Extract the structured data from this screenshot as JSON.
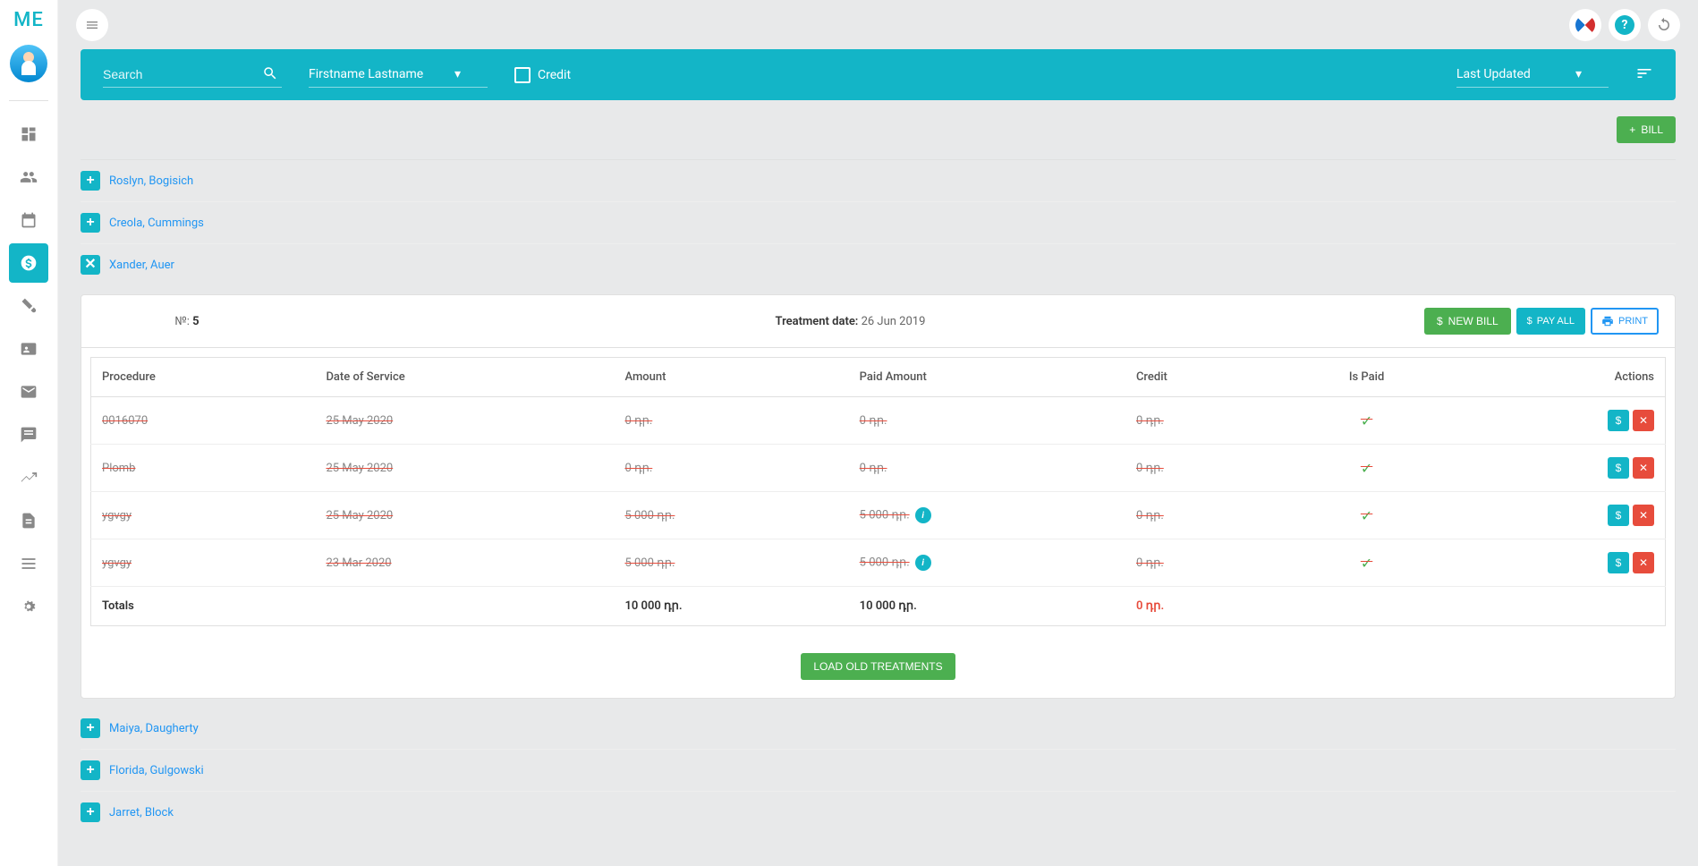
{
  "logo": "ME",
  "top": {
    "search_placeholder": "Search",
    "name_dropdown": "Firstname Lastname",
    "credit_label": "Credit",
    "sort_dropdown": "Last Updated",
    "bill_button": "BILL"
  },
  "patients": [
    {
      "name": "Roslyn, Bogisich",
      "expanded": false
    },
    {
      "name": "Creola, Cummings",
      "expanded": false
    },
    {
      "name": "Xander, Auer",
      "expanded": true
    },
    {
      "name": "Maiya, Daugherty",
      "expanded": false
    },
    {
      "name": "Florida, Gulgowski",
      "expanded": false
    },
    {
      "name": "Jarret, Block",
      "expanded": false
    }
  ],
  "treatment": {
    "number_label": "№:",
    "number": "5",
    "date_label": "Treatment date:",
    "date": "26 Jun 2019",
    "new_bill": "NEW BILL",
    "pay_all": "PAY ALL",
    "print": "PRINT",
    "load_old": "LOAD OLD TREATMENTS"
  },
  "table": {
    "headers": {
      "procedure": "Procedure",
      "dos": "Date of Service",
      "amount": "Amount",
      "paid": "Paid Amount",
      "credit": "Credit",
      "ispaid": "Is Paid",
      "actions": "Actions"
    },
    "rows": [
      {
        "procedure": "0016070",
        "dos": "25 May 2020",
        "amount": "0 դր.",
        "paid": "0 դր.",
        "credit": "0 դր.",
        "info": false
      },
      {
        "procedure": "Plomb",
        "dos": "25 May 2020",
        "amount": "0 դր.",
        "paid": "0 դր.",
        "credit": "0 դր.",
        "info": false
      },
      {
        "procedure": "ygvgy",
        "dos": "25 May 2020",
        "amount": "5 000 դր.",
        "paid": "5 000 դր.",
        "credit": "0 դր.",
        "info": true
      },
      {
        "procedure": "ygvgy",
        "dos": "23 Mar 2020",
        "amount": "5 000 դր.",
        "paid": "5 000 դր.",
        "credit": "0 դր.",
        "info": true
      }
    ],
    "totals": {
      "label": "Totals",
      "amount": "10 000 դր.",
      "paid": "10 000 դր.",
      "credit": "0 դր."
    }
  }
}
